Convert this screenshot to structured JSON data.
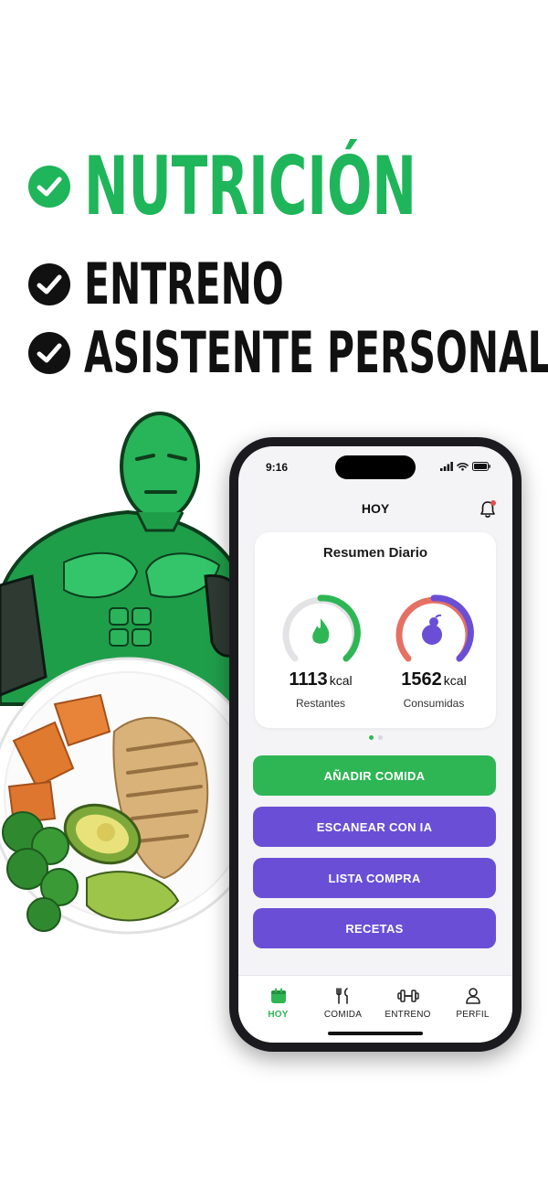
{
  "features": [
    {
      "label": "NUTRICIÓN",
      "color": "#1fb55a"
    },
    {
      "label": "ENTRENO",
      "color": "#111111"
    },
    {
      "label": "ASISTENTE PERSONAL",
      "color": "#111111"
    }
  ],
  "phone": {
    "status_time": "9:16",
    "header_title": "HOY",
    "summary": {
      "title": "Resumen Diario",
      "remaining": {
        "value": "1113",
        "unit": "kcal",
        "label": "Restantes",
        "color": "#2fb654"
      },
      "consumed": {
        "value": "1562",
        "unit": "kcal",
        "label": "Consumidas",
        "color": "#6a4fd6"
      }
    },
    "pager": {
      "pages": 2,
      "active": 1
    },
    "buttons": [
      {
        "label": "AÑADIR COMIDA",
        "color": "#2fb654"
      },
      {
        "label": "ESCANEAR CON IA",
        "color": "#6a4fd6"
      },
      {
        "label": "LISTA COMPRA",
        "color": "#6a4fd6"
      },
      {
        "label": "RECETAS",
        "color": "#6a4fd6"
      }
    ],
    "nav": [
      {
        "label": "HOY",
        "icon": "calendar-icon",
        "active": true
      },
      {
        "label": "COMIDA",
        "icon": "fork-knife-icon",
        "active": false
      },
      {
        "label": "ENTRENO",
        "icon": "dumbbell-icon",
        "active": false
      },
      {
        "label": "PERFIL",
        "icon": "user-icon",
        "active": false
      }
    ]
  }
}
